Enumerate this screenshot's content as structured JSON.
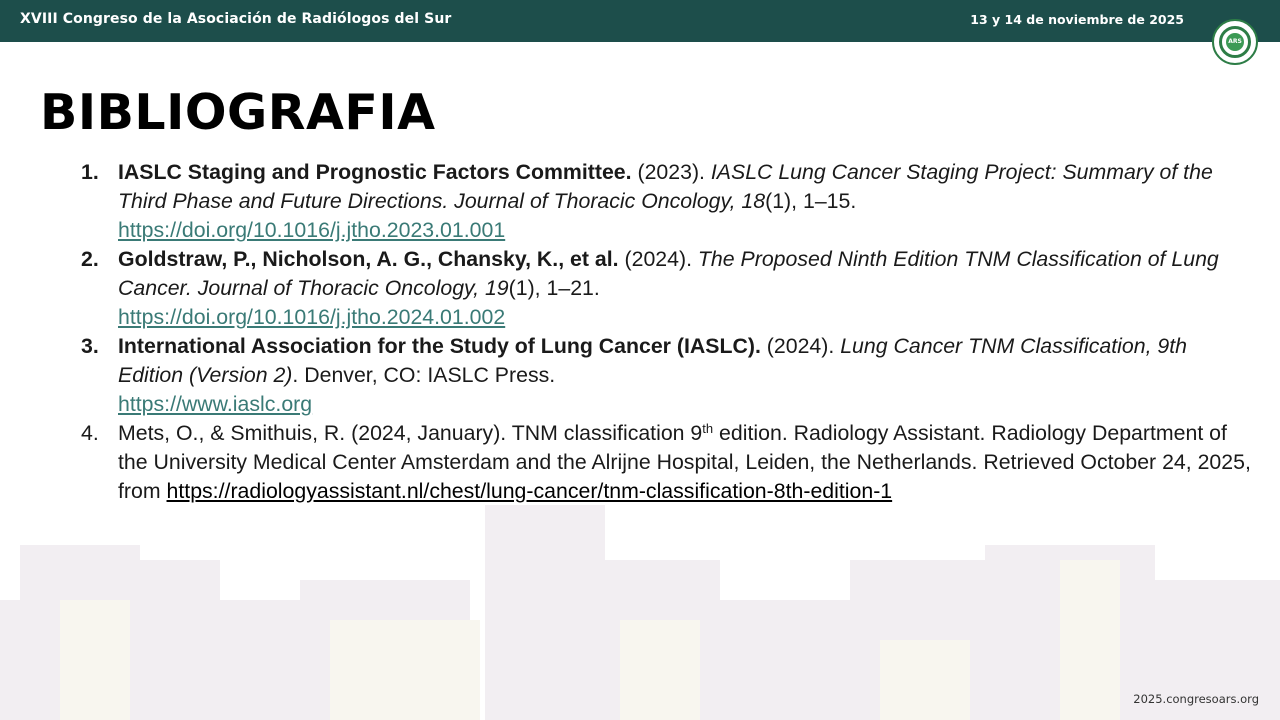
{
  "header": {
    "event_title": "XVIII Congreso de la Asociación de Radiólogos del Sur",
    "event_date": "13 y 14 de noviembre de 2025",
    "logo_text": "ARS"
  },
  "slide": {
    "title": "BIBLIOGRAFIA",
    "references": [
      {
        "number": "1.",
        "authors": "IASLC Staging and Prognostic Factors Committee.",
        "year": " (2023). ",
        "title_italic": "IASLC Lung Cancer Staging Project: Summary of the Third Phase and Future Directions. Journal of Thoracic Oncology, 18",
        "rest": "(1), 1–15.",
        "link": "https://doi.org/10.1016/j.jtho.2023.01.001"
      },
      {
        "number": "2.",
        "authors": "Goldstraw, P., Nicholson, A. G., Chansky, K., et al.",
        "year": " (2024). ",
        "title_italic": "The Proposed Ninth Edition TNM Classification of Lung Cancer. Journal of Thoracic Oncology, 19",
        "rest": "(1), 1–21.",
        "link": "https://doi.org/10.1016/j.jtho.2024.01.002"
      },
      {
        "number": "3.",
        "authors": "International Association for the Study of Lung Cancer (IASLC).",
        "year": " (2024). ",
        "title_italic": "Lung Cancer TNM Classification, 9th Edition (Version 2)",
        "rest": ". Denver, CO: IASLC Press.",
        "link": "https://www.iaslc.org"
      },
      {
        "number": "4.",
        "text_before": "Mets, O., & Smithuis, R. (2024, January). TNM classification 9",
        "superscript": "th",
        "text_after": " edition. Radiology Assistant. Radiology Department of the University Medical Center Amsterdam and the Alrijne Hospital, Leiden, the Netherlands. Retrieved October 24, 2025, from ",
        "link": "https://radiologyassistant.nl/chest/lung-cancer/tnm-classification-8th-edition-1"
      }
    ]
  },
  "footer": {
    "url": "2025.congresoars.org"
  },
  "colors": {
    "header_bg": "#1d4e4b",
    "link_teal": "#3a7a76",
    "logo_green": "#2d7d46"
  }
}
